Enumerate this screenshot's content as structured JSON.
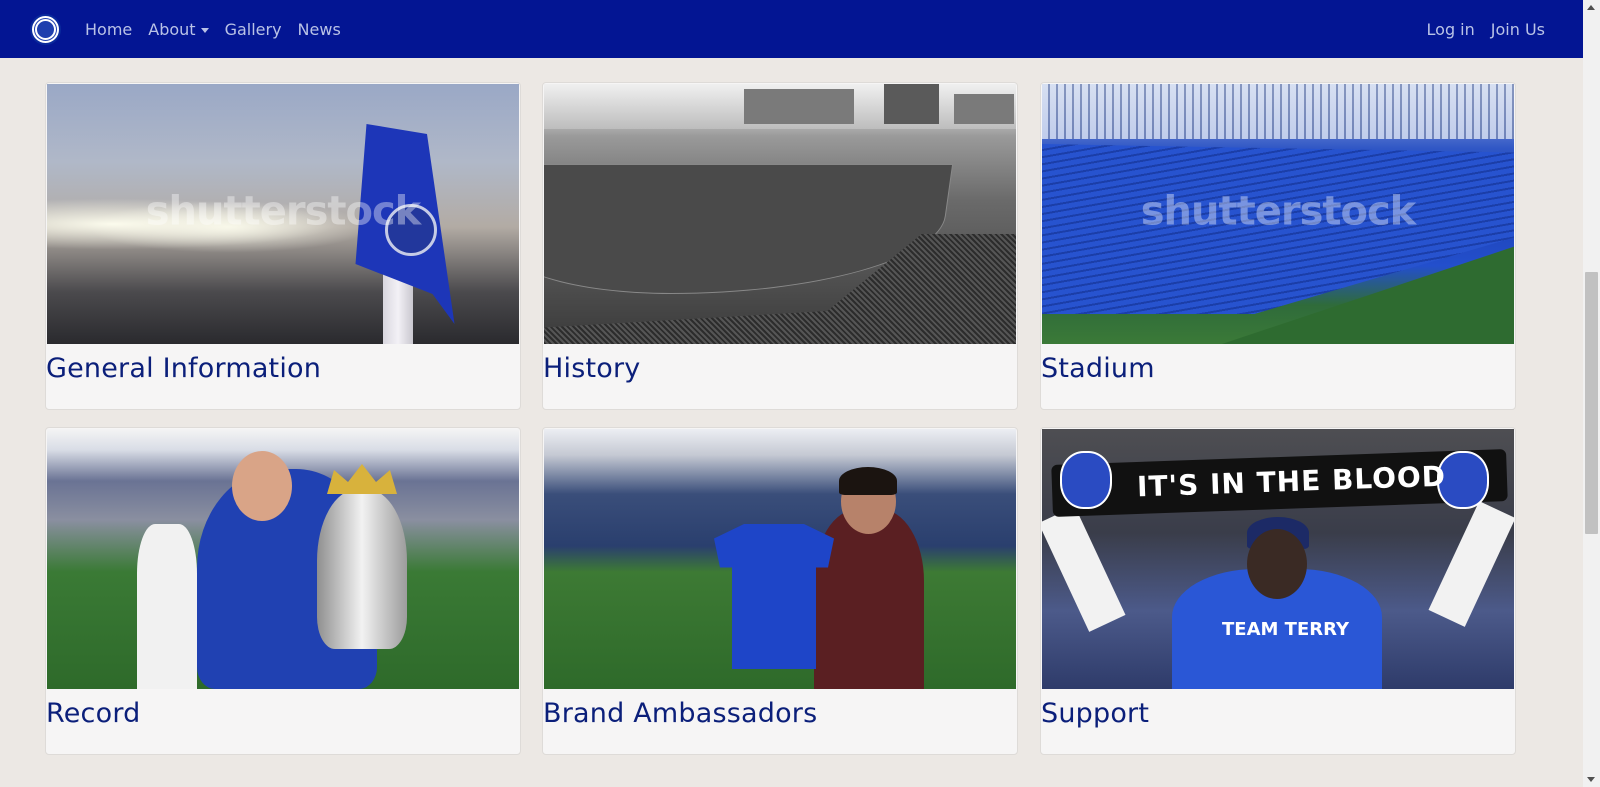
{
  "nav": {
    "logo_icon": "chelsea-crest-icon",
    "left": [
      {
        "label": "Home",
        "name": "nav-home-link"
      },
      {
        "label": "About",
        "name": "nav-about-dropdown",
        "dropdown": true
      },
      {
        "label": "Gallery",
        "name": "nav-gallery-link"
      },
      {
        "label": "News",
        "name": "nav-news-link"
      }
    ],
    "right": [
      {
        "label": "Log in",
        "name": "nav-login-link"
      },
      {
        "label": "Join Us",
        "name": "nav-join-link"
      }
    ]
  },
  "cards": [
    {
      "title": "General Information",
      "image": "corner-flag-image",
      "watermark": "shutterstock"
    },
    {
      "title": "History",
      "image": "historic-stadium-image",
      "watermark": ""
    },
    {
      "title": "Stadium",
      "image": "stamford-bridge-stands-image",
      "watermark": "shutterstock"
    },
    {
      "title": "Record",
      "image": "trophy-celebration-image",
      "watermark": ""
    },
    {
      "title": "Brand Ambassadors",
      "image": "ambassador-jersey-image",
      "watermark": ""
    },
    {
      "title": "Support",
      "image": "fan-scarf-image",
      "watermark": ""
    }
  ],
  "support_image": {
    "scarf_text": "IT'S IN THE BLOOD",
    "shirt_text": "TEAM TERRY"
  },
  "colors": {
    "navbar": "#031593",
    "nav_link": "#b9c2e6",
    "card_title": "#0b1f7a",
    "page_background": "#ece8e4"
  }
}
